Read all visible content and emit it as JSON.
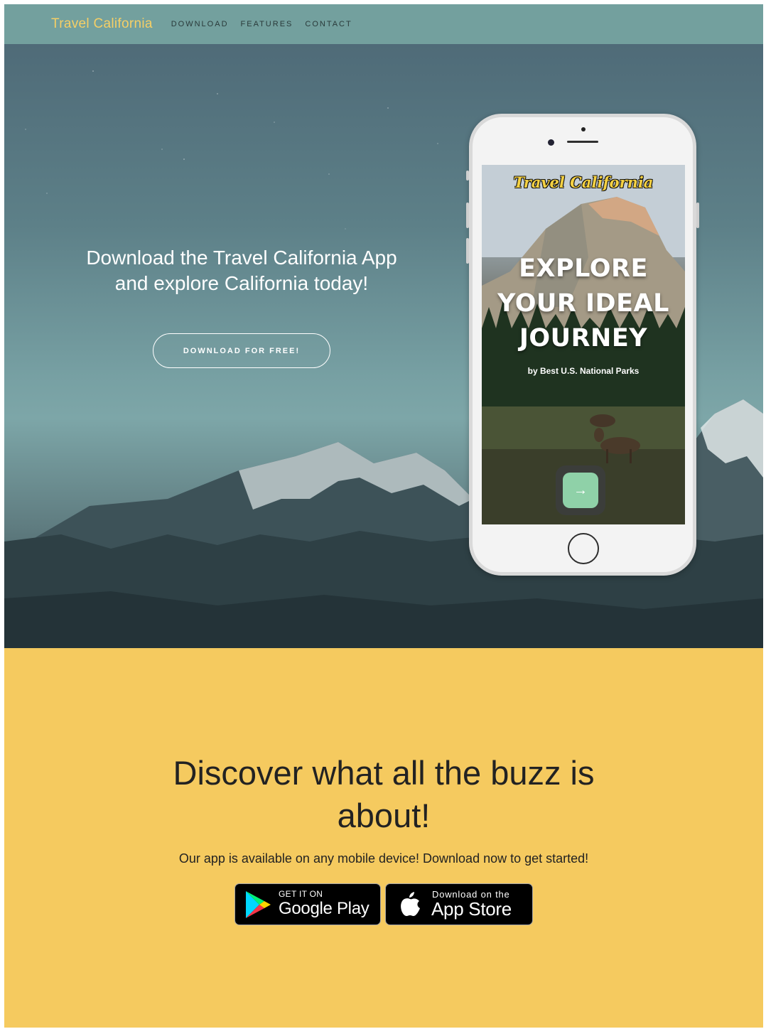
{
  "nav": {
    "brand": "Travel California",
    "links": [
      "DOWNLOAD",
      "FEATURES",
      "CONTACT"
    ]
  },
  "hero": {
    "heading_line1": "Download the Travel California App",
    "heading_line2": "and explore California today!",
    "button_label": "DOWNLOAD FOR FREE!"
  },
  "phone_screen": {
    "logo": "Travel California",
    "title_line1": "EXPLORE",
    "title_line2": "YOUR IDEAL",
    "title_line3": "JOURNEY",
    "subtitle": "by Best U.S. National Parks",
    "next_glyph": "→"
  },
  "download": {
    "heading": "Discover what all the buzz is about!",
    "text": "Our app is available on any mobile device! Download now to get started!",
    "google_play": {
      "small": "GET IT ON",
      "big": "Google Play"
    },
    "app_store": {
      "small": "Download on the",
      "big": "App Store"
    }
  },
  "colors": {
    "nav_bg": "#73a09e",
    "brand": "#f5cf66",
    "download_bg": "#f5ca5f",
    "app_button": "#8fd1a8"
  }
}
